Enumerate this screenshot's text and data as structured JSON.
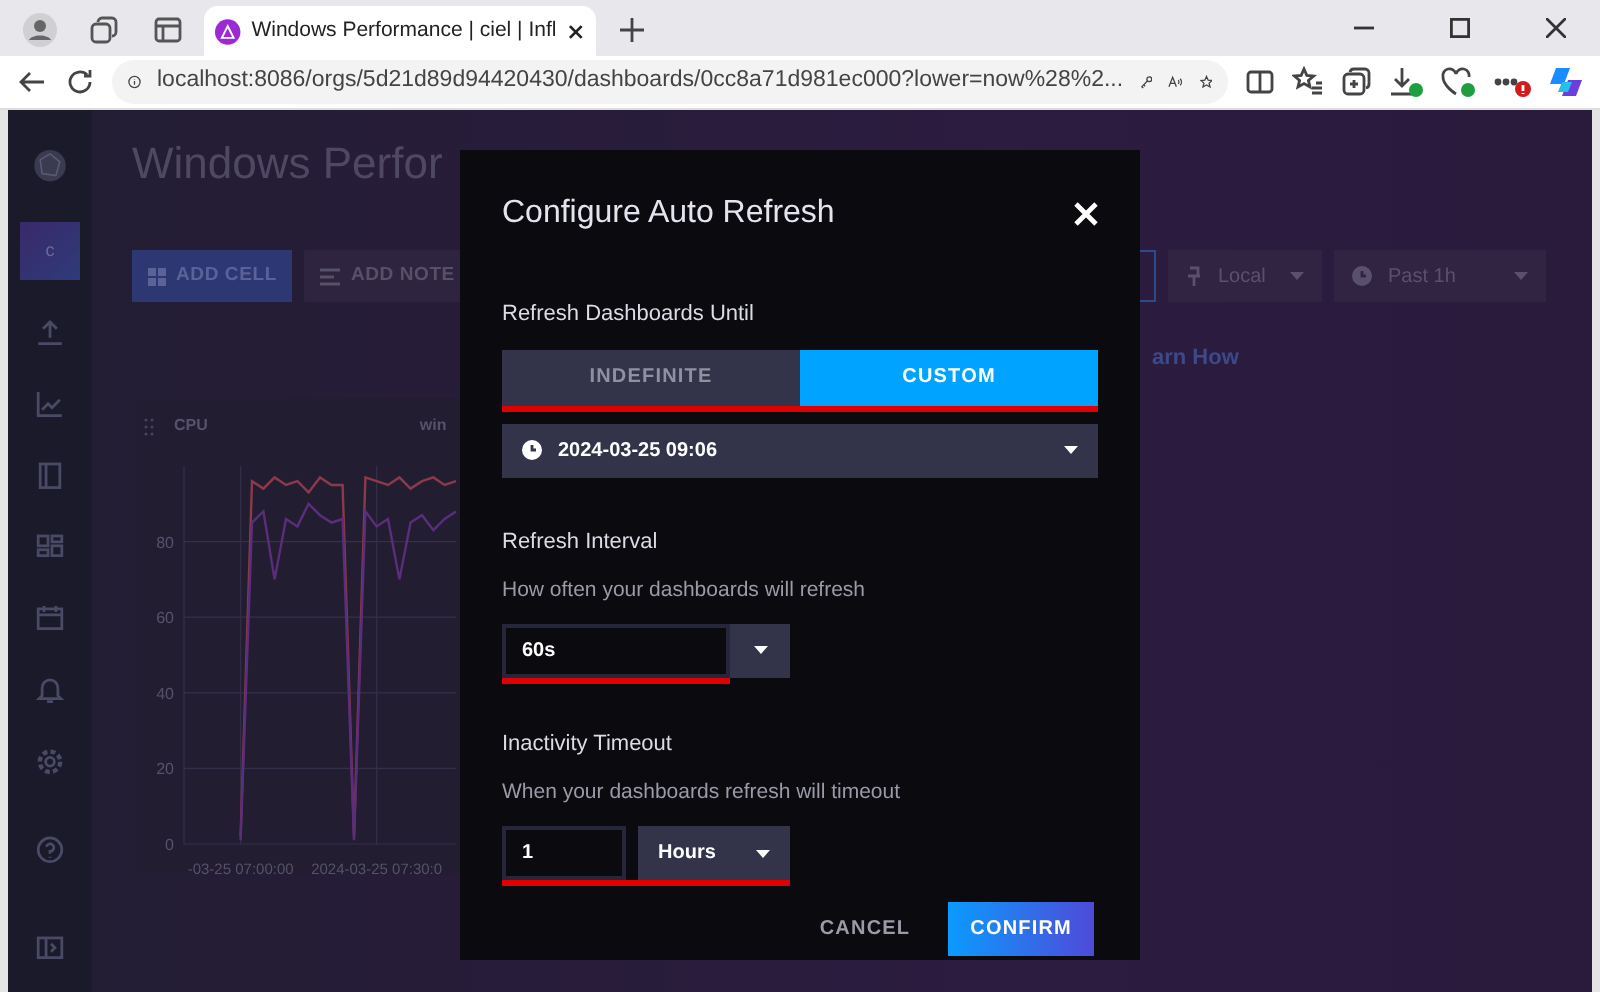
{
  "browser": {
    "tab_title": "Windows Performance | ciel | Infl",
    "url": "localhost:8086/orgs/5d21d89d94420430/dashboards/0cc8a71d981ec000?lower=now%28%2..."
  },
  "sidebar": {
    "avatar": "c"
  },
  "dashboard": {
    "title": "Windows Perfor",
    "toolbar": [
      {
        "label": "ADD CELL",
        "kind": "primary"
      },
      {
        "label": "ADD NOTE",
        "kind": "secondary"
      }
    ],
    "timezone": "Local",
    "time_range": "Past 1h",
    "link_fragment": "arn How",
    "cell": {
      "title": "CPU",
      "legend_fragment": "win",
      "chart_data": {
        "type": "line",
        "grid": true,
        "categories": [
          null,
          null,
          null,
          null,
          null,
          "-03-25 07:00:00",
          null,
          null,
          null,
          null,
          null,
          null,
          null,
          null,
          null,
          null,
          null,
          "2024-03-25 07:30:0",
          null,
          null,
          null,
          null,
          null,
          null,
          null
        ],
        "ylim": [
          0,
          100
        ],
        "yticks": [
          0,
          20,
          40,
          60,
          80
        ],
        "series": [
          {
            "color": "#8a3a4a",
            "values": [
              null,
              null,
              null,
              null,
              null,
              2,
              96,
              94,
              97,
              95,
              96,
              93,
              97,
              95,
              95,
              2,
              97,
              96,
              95,
              97,
              94,
              96,
              97,
              95,
              96
            ]
          },
          {
            "color": "#5a2e7a",
            "values": [
              null,
              null,
              null,
              null,
              null,
              1,
              85,
              88,
              70,
              86,
              84,
              90,
              87,
              85,
              86,
              1,
              88,
              84,
              86,
              70,
              85,
              87,
              83,
              86,
              88
            ]
          }
        ]
      }
    }
  },
  "modal": {
    "title": "Configure Auto Refresh",
    "until_label": "Refresh Dashboards Until",
    "until_options": [
      {
        "label": "INDEFINITE",
        "selected": false
      },
      {
        "label": "CUSTOM",
        "selected": true
      }
    ],
    "until_highlighted": true,
    "until_date": "2024-03-25 09:06",
    "interval_label": "Refresh Interval",
    "interval_help": "How often your dashboards will refresh",
    "interval_value": "60s",
    "interval_highlighted": true,
    "timeout_label": "Inactivity Timeout",
    "timeout_help": "When your dashboards refresh will timeout",
    "timeout_value": "1",
    "timeout_unit": "Hours",
    "timeout_highlighted": true,
    "buttons": [
      {
        "label": "CANCEL",
        "kind": "secondary"
      },
      {
        "label": "CONFIRM",
        "kind": "primary"
      }
    ]
  }
}
